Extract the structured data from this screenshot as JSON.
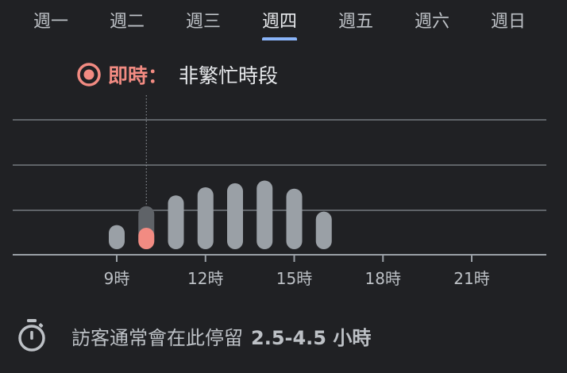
{
  "tabs": [
    "週一",
    "週二",
    "週三",
    "週四",
    "週五",
    "週六",
    "週日"
  ],
  "active_tab": "週四",
  "live": {
    "label": "即時",
    "separator": "：",
    "status": "非繁忙時段"
  },
  "footer": {
    "text": "訪客通常會在此停留",
    "value": "2.5-4.5 小時"
  },
  "colors": {
    "accent": "#8ab4f8",
    "live": "#f28b82",
    "bar": "#9aa0a6",
    "bar_live": "#5f6368",
    "grid": "#5f6368"
  },
  "chart_data": {
    "type": "bar",
    "x_hours": [
      9,
      10,
      11,
      12,
      13,
      14,
      15,
      16
    ],
    "values": [
      22,
      36,
      44,
      50,
      53,
      55,
      49,
      32
    ],
    "live_hour": 10,
    "live_value": 20,
    "xlim": [
      6,
      24
    ],
    "ylim": [
      0,
      100
    ],
    "tick_hours": [
      9,
      12,
      15,
      18,
      21
    ],
    "tick_labels": [
      "9時",
      "12時",
      "15時",
      "18時",
      "21時"
    ],
    "grid": true
  }
}
